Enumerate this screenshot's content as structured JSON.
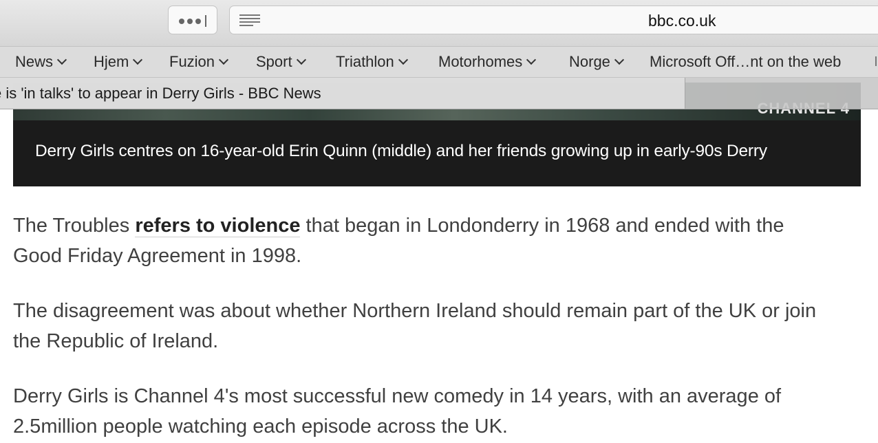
{
  "browser": {
    "address": {
      "domain": "bbc.co.uk"
    },
    "bookmarks": [
      {
        "label": "News"
      },
      {
        "label": "Hjem"
      },
      {
        "label": "Fuzion"
      },
      {
        "label": "Sport"
      },
      {
        "label": "Triathlon"
      },
      {
        "label": "Motorhomes"
      },
      {
        "label": "Norge"
      },
      {
        "label": "Microsoft Off…nt on the web"
      }
    ],
    "tab": {
      "title": "e is 'in talks' to appear in Derry Girls - BBC News"
    }
  },
  "article": {
    "image_credit": "CHANNEL 4",
    "caption": "Derry Girls centres on 16-year-old Erin Quinn (middle) and her friends growing up in early-90s Derry",
    "paragraphs": [
      {
        "before": "The Troubles ",
        "link": "refers to violence",
        "after": " that began in Londonderry in 1968 and ended with the Good Friday Agreement in 1998."
      },
      {
        "text": "The disagreement was about whether Northern Ireland should remain part of the UK or join the Republic of Ireland."
      },
      {
        "text": "Derry Girls is Channel 4's most successful new comedy in 14 years, with an average of 2.5million people watching each episode across the UK."
      }
    ]
  }
}
